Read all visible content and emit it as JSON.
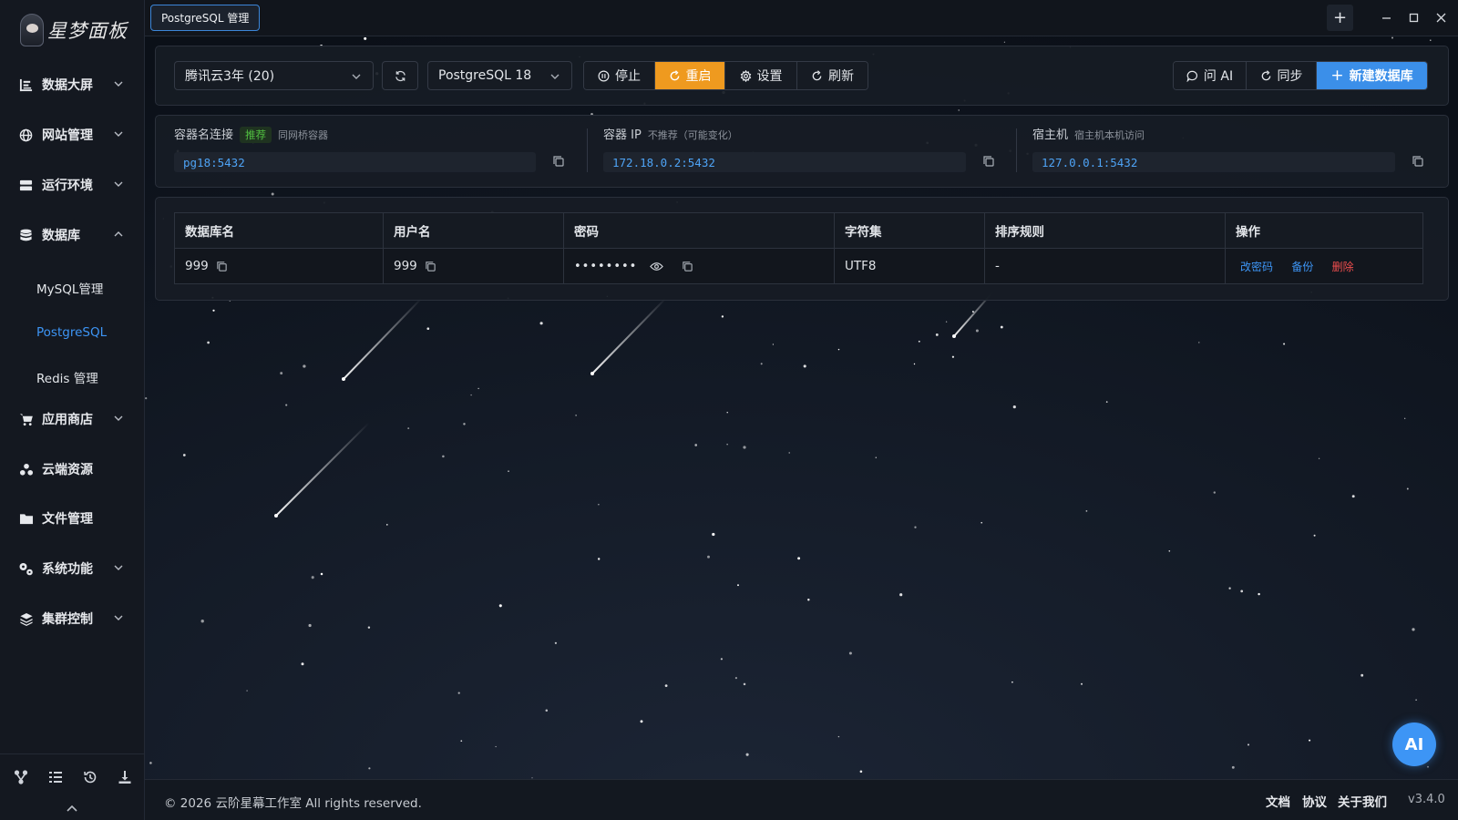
{
  "app": {
    "logo_text": "星梦面板",
    "tab_title": "PostgreSQL 管理"
  },
  "sidebar": {
    "items": [
      {
        "label": "数据大屏",
        "icon": "chart-bar-icon",
        "expandable": true
      },
      {
        "label": "网站管理",
        "icon": "globe-icon",
        "expandable": true
      },
      {
        "label": "运行环境",
        "icon": "server-icon",
        "expandable": true
      },
      {
        "label": "数据库",
        "icon": "database-icon",
        "expandable": true,
        "expanded": true
      },
      {
        "label": "应用商店",
        "icon": "cart-icon",
        "expandable": true
      },
      {
        "label": "云端资源",
        "icon": "cloud-share-icon",
        "expandable": false
      },
      {
        "label": "文件管理",
        "icon": "folder-icon",
        "expandable": false
      },
      {
        "label": "系统功能",
        "icon": "gears-icon",
        "expandable": true
      },
      {
        "label": "集群控制",
        "icon": "layers-icon",
        "expandable": true
      }
    ],
    "sub_items": [
      {
        "label": "MySQL管理",
        "active": false
      },
      {
        "label": "PostgreSQL",
        "active": true
      },
      {
        "label": "Redis 管理",
        "active": false
      }
    ],
    "bottom_icons": [
      "branch-icon",
      "list-icon",
      "history-icon",
      "download-icon"
    ]
  },
  "toolbar": {
    "server_select": "腾讯云3年 (20)",
    "version_select": "PostgreSQL 18",
    "stop_label": "停止",
    "restart_label": "重启",
    "settings_label": "设置",
    "refresh_label": "刷新",
    "ask_ai_label": "问 AI",
    "sync_label": "同步",
    "new_db_label": "新建数据库"
  },
  "connection": {
    "container": {
      "title": "容器名连接",
      "tag": "推荐",
      "hint": "同网桥容器",
      "value": "pg18:5432"
    },
    "container_ip": {
      "title": "容器 IP",
      "hint": "不推荐（可能变化）",
      "value": "172.18.0.2:5432"
    },
    "host": {
      "title": "宿主机",
      "hint": "宿主机本机访问",
      "value": "127.0.0.1:5432"
    }
  },
  "table": {
    "headers": [
      "数据库名",
      "用户名",
      "密码",
      "字符集",
      "排序规则",
      "操作"
    ],
    "rows": [
      {
        "db_name": "999",
        "username": "999",
        "password": "••••••••",
        "charset": "UTF8",
        "collation": "-",
        "actions": {
          "change_pw": "改密码",
          "backup": "备份",
          "delete": "删除"
        }
      }
    ]
  },
  "ai_float_label": "AI",
  "footer": {
    "copyright": "© 2026 云阶星幕工作室 All rights reserved.",
    "docs": "文档",
    "agreement": "协议",
    "about": "关于我们",
    "version": "v3.4.0"
  },
  "colors": {
    "accent": "#3d95f5",
    "orange": "#ef9a1f",
    "danger": "#ef4e4e",
    "success": "#51c141",
    "background": "#0c1119"
  }
}
